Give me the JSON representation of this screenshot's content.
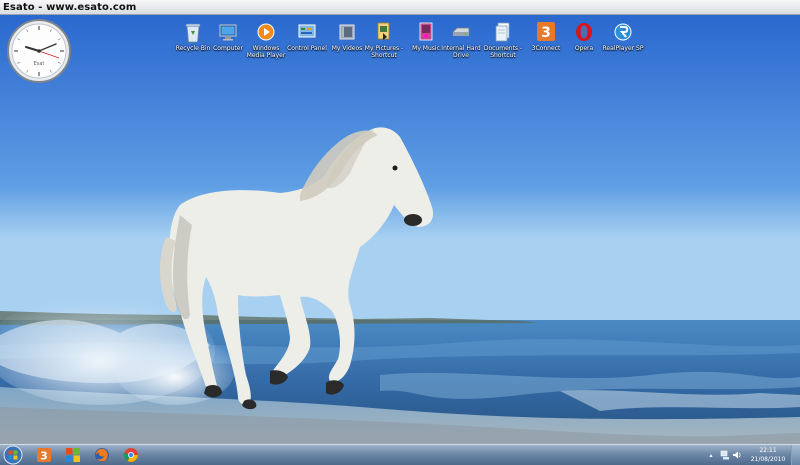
{
  "window": {
    "title": "Esato - www.esato.com"
  },
  "clock": {
    "brand": "Esat"
  },
  "desktop_icons": [
    {
      "label": "Recycle Bin",
      "icon": "recycle-bin-icon"
    },
    {
      "label": "Computer",
      "icon": "computer-icon"
    },
    {
      "label": "Windows Media Player",
      "icon": "media-player-icon"
    },
    {
      "label": "Control Panel",
      "icon": "control-panel-icon"
    },
    {
      "label": "My Videos",
      "icon": "videos-folder-icon"
    },
    {
      "label": "My Pictures - Shortcut",
      "icon": "pictures-folder-icon"
    },
    {
      "label": "My Music",
      "icon": "music-folder-icon"
    },
    {
      "label": "Internal Hard Drive",
      "icon": "hard-drive-icon"
    },
    {
      "label": "Documents - Shortcut",
      "icon": "documents-icon"
    },
    {
      "label": "3Connect",
      "icon": "three-connect-icon"
    },
    {
      "label": "Opera",
      "icon": "opera-icon"
    },
    {
      "label": "RealPlayer SP",
      "icon": "realplayer-icon"
    }
  ],
  "taskbar": {
    "pinned": [
      {
        "icon": "three-connect-icon"
      },
      {
        "icon": "app-tiles-icon"
      },
      {
        "icon": "firefox-icon"
      },
      {
        "icon": "chrome-icon"
      }
    ],
    "time": "22:11",
    "date": "21/08/2010"
  },
  "colors": {
    "sky_top": "#2f6fd1",
    "sky_bottom": "#a9d3f2",
    "sea": "#3f79b6",
    "taskbar": "#6d87a6"
  }
}
